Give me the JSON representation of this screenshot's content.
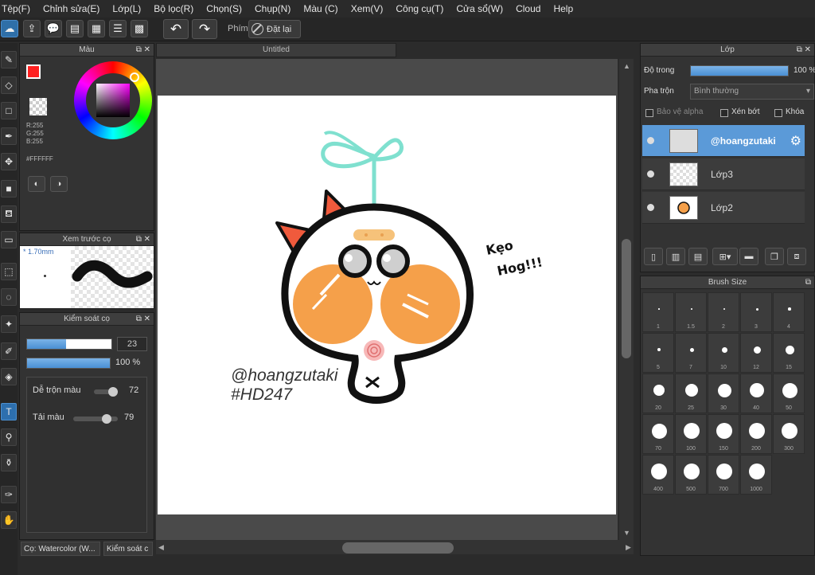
{
  "menu": [
    "Tệp(F)",
    "Chỉnh sửa(E)",
    "Lớp(L)",
    "Bộ lọc(R)",
    "Chọn(S)",
    "Chụp(N)",
    "Màu (C)",
    "Xem(V)",
    "Công cụ(T)",
    "Cửa sổ(W)",
    "Cloud",
    "Help"
  ],
  "toolbar": {
    "phim_label": "Phím",
    "reset_label": "Đặt lại"
  },
  "document": {
    "tab_title": "Untitled"
  },
  "color_panel": {
    "title": "Màu",
    "r": "R:255",
    "g": "G:255",
    "b": "B:255",
    "hex": "#FFFFFF",
    "fg_color": "#ff2020",
    "bg_color": "#ffffff"
  },
  "brush_preview": {
    "title": "Xem trước cọ",
    "size": "1.70mm"
  },
  "brush_control": {
    "title": "Kiểm soát cọ",
    "size_value": "23",
    "opacity_value": "100 %",
    "blend_label": "Dễ trộn màu",
    "blend_value": "72",
    "reload_label": "Tải màu",
    "reload_value": "79"
  },
  "bottom_tabs": [
    "Cọ: Watercolor (W...",
    "Kiểm soát c"
  ],
  "layer_panel": {
    "title": "Lớp",
    "opacity_label": "Độ trong",
    "opacity_value": "100 %",
    "opacity_fraction": 1.0,
    "blend_label": "Pha trộn",
    "blend_value": "Bình thường",
    "protect_alpha": "Bảo vệ alpha",
    "clipping": "Xén bớt",
    "lock": "Khóa",
    "layers": [
      {
        "name": "@hoangzutaki",
        "selected": true
      },
      {
        "name": "Lớp3",
        "selected": false
      },
      {
        "name": "Lớp2",
        "selected": false
      }
    ]
  },
  "brush_size": {
    "title": "Brush Size",
    "sizes": [
      "1",
      "1.5",
      "2",
      "3",
      "4",
      "5",
      "7",
      "10",
      "12",
      "15",
      "20",
      "25",
      "30",
      "40",
      "50",
      "70",
      "100",
      "150",
      "200",
      "300",
      "400",
      "500",
      "700",
      "1000"
    ]
  },
  "artwork": {
    "handle": "@hoangzutaki",
    "tag": "#HD247",
    "caption_line1": "Kẹo",
    "caption_line2": "Hog!!!"
  },
  "colors": {
    "accent": "#4a8fd4",
    "layer_selected": "#5b9ad8",
    "cheek": "#f5a04a",
    "sprout": "#7fe0cf",
    "bow": "#f05a3c"
  }
}
